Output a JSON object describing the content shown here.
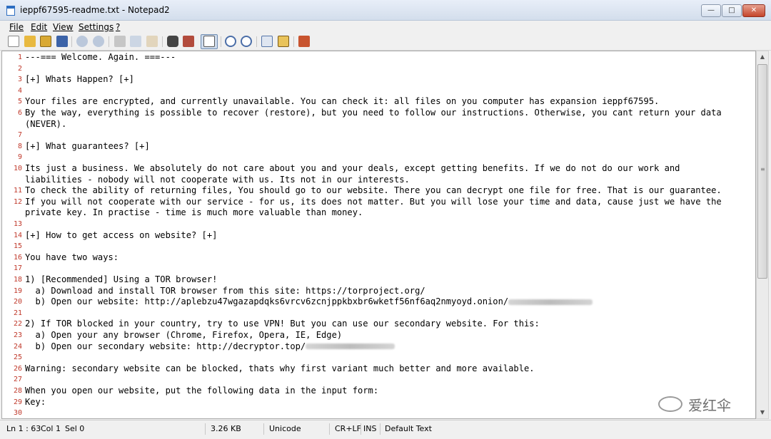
{
  "window": {
    "title": "ieppf67595-readme.txt - Notepad2",
    "min_glyph": "—",
    "max_glyph": "□",
    "close_glyph": "✕"
  },
  "menu": {
    "file": "File",
    "edit": "Edit",
    "view": "View",
    "settings": "Settings",
    "help": "?"
  },
  "toolbar_icons": [
    "new-icon",
    "open-icon",
    "browse-icon",
    "save-icon",
    "undo-icon",
    "redo-icon",
    "cut-icon",
    "copy-icon",
    "paste-icon",
    "find-icon",
    "replace-icon",
    "word-wrap-icon",
    "zoom-in-icon",
    "zoom-out-icon",
    "view-scheme-icon",
    "customize-schemes-icon",
    "exit-icon"
  ],
  "editor": {
    "lines": [
      {
        "n": "1",
        "text": "---=== Welcome. Again. ===---"
      },
      {
        "n": "2",
        "text": ""
      },
      {
        "n": "3",
        "text": "[+] Whats Happen? [+]"
      },
      {
        "n": "4",
        "text": ""
      },
      {
        "n": "5",
        "text": "Your files are encrypted, and currently unavailable. You can check it: all files on you computer has expansion ieppf67595."
      },
      {
        "n": "6",
        "text": "By the way, everything is possible to recover (restore), but you need to follow our instructions. Otherwise, you cant return your data"
      },
      {
        "n": "",
        "text": "(NEVER)."
      },
      {
        "n": "7",
        "text": ""
      },
      {
        "n": "8",
        "text": "[+] What guarantees? [+]"
      },
      {
        "n": "9",
        "text": ""
      },
      {
        "n": "10",
        "text": "Its just a business. We absolutely do not care about you and your deals, except getting benefits. If we do not do our work and"
      },
      {
        "n": "",
        "text": "liabilities - nobody will not cooperate with us. Its not in our interests."
      },
      {
        "n": "11",
        "text": "To check the ability of returning files, You should go to our website. There you can decrypt one file for free. That is our guarantee."
      },
      {
        "n": "12",
        "text": "If you will not cooperate with our service - for us, its does not matter. But you will lose your time and data, cause just we have the"
      },
      {
        "n": "",
        "text": "private key. In practise - time is much more valuable than money."
      },
      {
        "n": "13",
        "text": ""
      },
      {
        "n": "14",
        "text": "[+] How to get access on website? [+]"
      },
      {
        "n": "15",
        "text": ""
      },
      {
        "n": "16",
        "text": "You have two ways:"
      },
      {
        "n": "17",
        "text": ""
      },
      {
        "n": "18",
        "text": "1) [Recommended] Using a TOR browser!"
      },
      {
        "n": "19",
        "text": "  a) Download and install TOR browser from this site: https://torproject.org/"
      },
      {
        "n": "20",
        "text": "  b) Open our website: http://aplebzu47wgazapdqks6vrcv6zcnjppkbxbr6wketf56nf6aq2nmyoyd.onion/",
        "redacted": true
      },
      {
        "n": "21",
        "text": ""
      },
      {
        "n": "22",
        "text": "2) If TOR blocked in your country, try to use VPN! But you can use our secondary website. For this:"
      },
      {
        "n": "23",
        "text": "  a) Open your any browser (Chrome, Firefox, Opera, IE, Edge)"
      },
      {
        "n": "24",
        "text": "  b) Open our secondary website: http://decryptor.top/",
        "redacted": true
      },
      {
        "n": "25",
        "text": ""
      },
      {
        "n": "26",
        "text": "Warning: secondary website can be blocked, thats why first variant much better and more available."
      },
      {
        "n": "27",
        "text": ""
      },
      {
        "n": "28",
        "text": "When you open our website, put the following data in the input form:"
      },
      {
        "n": "29",
        "text": "Key:"
      },
      {
        "n": "30",
        "text": ""
      }
    ]
  },
  "status": {
    "position": "Ln 1 : 63",
    "column": "Col 1",
    "selection": "Sel 0",
    "size": "3.26 KB",
    "encoding": "Unicode",
    "eol": "CR+LF",
    "mode": "INS",
    "scheme": "Default Text"
  },
  "watermark": {
    "text": "爱红伞"
  },
  "colors": {
    "line_number": "#c0392b",
    "titlebar": "#d3deec",
    "close_button": "#c5452b"
  }
}
